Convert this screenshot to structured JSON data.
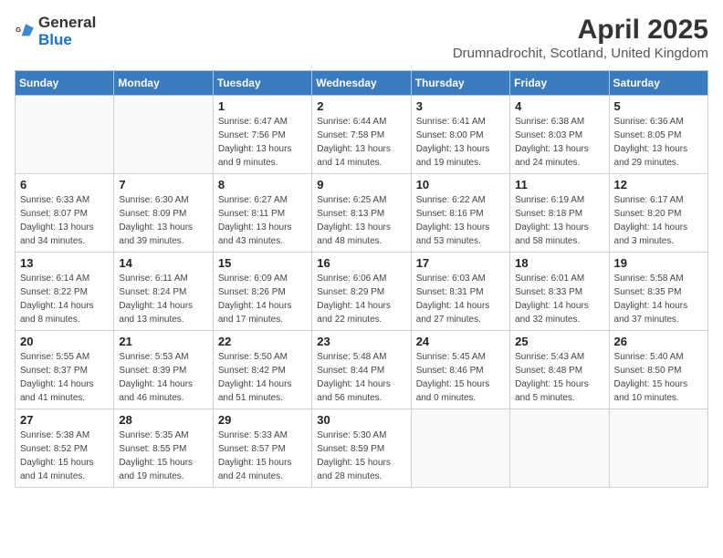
{
  "logo": {
    "general": "General",
    "blue": "Blue"
  },
  "title": "April 2025",
  "location": "Drumnadrochit, Scotland, United Kingdom",
  "days_of_week": [
    "Sunday",
    "Monday",
    "Tuesday",
    "Wednesday",
    "Thursday",
    "Friday",
    "Saturday"
  ],
  "weeks": [
    [
      {
        "day": "",
        "info": ""
      },
      {
        "day": "",
        "info": ""
      },
      {
        "day": "1",
        "info": "Sunrise: 6:47 AM\nSunset: 7:56 PM\nDaylight: 13 hours and 9 minutes."
      },
      {
        "day": "2",
        "info": "Sunrise: 6:44 AM\nSunset: 7:58 PM\nDaylight: 13 hours and 14 minutes."
      },
      {
        "day": "3",
        "info": "Sunrise: 6:41 AM\nSunset: 8:00 PM\nDaylight: 13 hours and 19 minutes."
      },
      {
        "day": "4",
        "info": "Sunrise: 6:38 AM\nSunset: 8:03 PM\nDaylight: 13 hours and 24 minutes."
      },
      {
        "day": "5",
        "info": "Sunrise: 6:36 AM\nSunset: 8:05 PM\nDaylight: 13 hours and 29 minutes."
      }
    ],
    [
      {
        "day": "6",
        "info": "Sunrise: 6:33 AM\nSunset: 8:07 PM\nDaylight: 13 hours and 34 minutes."
      },
      {
        "day": "7",
        "info": "Sunrise: 6:30 AM\nSunset: 8:09 PM\nDaylight: 13 hours and 39 minutes."
      },
      {
        "day": "8",
        "info": "Sunrise: 6:27 AM\nSunset: 8:11 PM\nDaylight: 13 hours and 43 minutes."
      },
      {
        "day": "9",
        "info": "Sunrise: 6:25 AM\nSunset: 8:13 PM\nDaylight: 13 hours and 48 minutes."
      },
      {
        "day": "10",
        "info": "Sunrise: 6:22 AM\nSunset: 8:16 PM\nDaylight: 13 hours and 53 minutes."
      },
      {
        "day": "11",
        "info": "Sunrise: 6:19 AM\nSunset: 8:18 PM\nDaylight: 13 hours and 58 minutes."
      },
      {
        "day": "12",
        "info": "Sunrise: 6:17 AM\nSunset: 8:20 PM\nDaylight: 14 hours and 3 minutes."
      }
    ],
    [
      {
        "day": "13",
        "info": "Sunrise: 6:14 AM\nSunset: 8:22 PM\nDaylight: 14 hours and 8 minutes."
      },
      {
        "day": "14",
        "info": "Sunrise: 6:11 AM\nSunset: 8:24 PM\nDaylight: 14 hours and 13 minutes."
      },
      {
        "day": "15",
        "info": "Sunrise: 6:09 AM\nSunset: 8:26 PM\nDaylight: 14 hours and 17 minutes."
      },
      {
        "day": "16",
        "info": "Sunrise: 6:06 AM\nSunset: 8:29 PM\nDaylight: 14 hours and 22 minutes."
      },
      {
        "day": "17",
        "info": "Sunrise: 6:03 AM\nSunset: 8:31 PM\nDaylight: 14 hours and 27 minutes."
      },
      {
        "day": "18",
        "info": "Sunrise: 6:01 AM\nSunset: 8:33 PM\nDaylight: 14 hours and 32 minutes."
      },
      {
        "day": "19",
        "info": "Sunrise: 5:58 AM\nSunset: 8:35 PM\nDaylight: 14 hours and 37 minutes."
      }
    ],
    [
      {
        "day": "20",
        "info": "Sunrise: 5:55 AM\nSunset: 8:37 PM\nDaylight: 14 hours and 41 minutes."
      },
      {
        "day": "21",
        "info": "Sunrise: 5:53 AM\nSunset: 8:39 PM\nDaylight: 14 hours and 46 minutes."
      },
      {
        "day": "22",
        "info": "Sunrise: 5:50 AM\nSunset: 8:42 PM\nDaylight: 14 hours and 51 minutes."
      },
      {
        "day": "23",
        "info": "Sunrise: 5:48 AM\nSunset: 8:44 PM\nDaylight: 14 hours and 56 minutes."
      },
      {
        "day": "24",
        "info": "Sunrise: 5:45 AM\nSunset: 8:46 PM\nDaylight: 15 hours and 0 minutes."
      },
      {
        "day": "25",
        "info": "Sunrise: 5:43 AM\nSunset: 8:48 PM\nDaylight: 15 hours and 5 minutes."
      },
      {
        "day": "26",
        "info": "Sunrise: 5:40 AM\nSunset: 8:50 PM\nDaylight: 15 hours and 10 minutes."
      }
    ],
    [
      {
        "day": "27",
        "info": "Sunrise: 5:38 AM\nSunset: 8:52 PM\nDaylight: 15 hours and 14 minutes."
      },
      {
        "day": "28",
        "info": "Sunrise: 5:35 AM\nSunset: 8:55 PM\nDaylight: 15 hours and 19 minutes."
      },
      {
        "day": "29",
        "info": "Sunrise: 5:33 AM\nSunset: 8:57 PM\nDaylight: 15 hours and 24 minutes."
      },
      {
        "day": "30",
        "info": "Sunrise: 5:30 AM\nSunset: 8:59 PM\nDaylight: 15 hours and 28 minutes."
      },
      {
        "day": "",
        "info": ""
      },
      {
        "day": "",
        "info": ""
      },
      {
        "day": "",
        "info": ""
      }
    ]
  ]
}
